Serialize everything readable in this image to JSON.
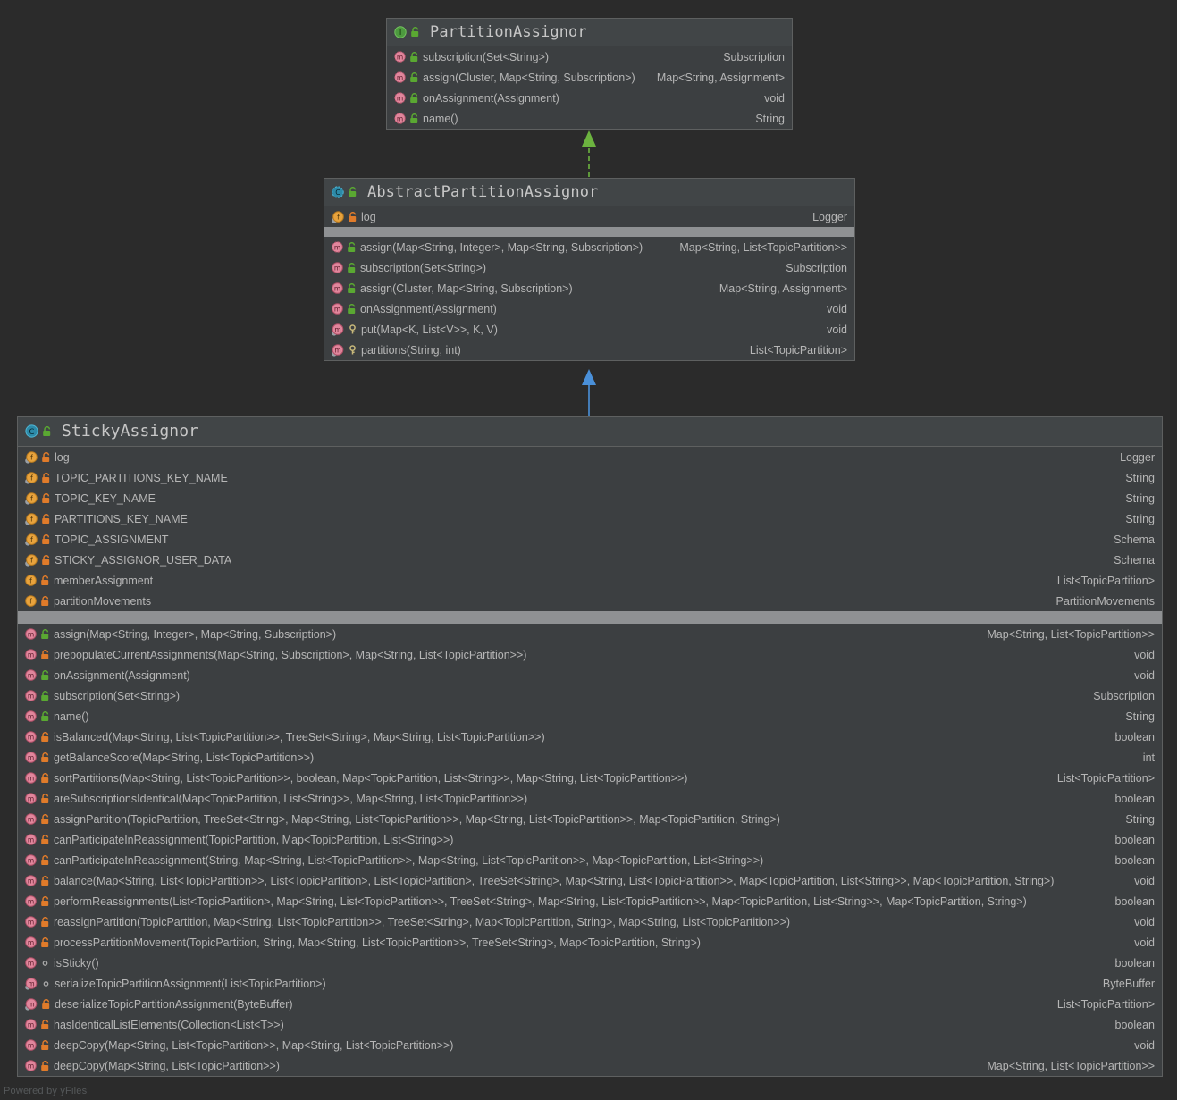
{
  "watermark": "Powered by yFiles",
  "colors": {
    "canvas": "#2b2b2b",
    "box_bg": "#3c3f41",
    "header_bg": "#414547",
    "border": "#5e6060",
    "separator_band": "#8f9193",
    "text": "#b6b6b6",
    "title_text": "#c7c7c7",
    "implements_arrow": "#6cb33f",
    "extends_arrow": "#4a90d9",
    "interface_icon": "#3c9f3c",
    "class_icon": "#2fa8c4",
    "method_icon": "#d9607a",
    "field_icon": "#e8a33d",
    "lock_public": "#5aa832",
    "lock_private": "#e07b2a"
  },
  "connectors": [
    {
      "name": "implements-arrow",
      "style": "dashed",
      "color": "#6cb33f",
      "from": "AbstractPartitionAssignor",
      "to": "PartitionAssignor"
    },
    {
      "name": "extends-arrow",
      "style": "solid",
      "color": "#4a90d9",
      "from": "StickyAssignor",
      "to": "AbstractPartitionAssignor"
    }
  ],
  "classes": [
    {
      "id": "partition-assignor",
      "name": "PartitionAssignor",
      "stereotype": "interface",
      "icon": "interface-icon",
      "visibility_icon": "lock-public-icon",
      "fields": [],
      "methods": [
        {
          "signature": "subscription(Set<String>)",
          "type": "Subscription",
          "icon": "method-abstract-icon",
          "visibility": "lock-public-icon"
        },
        {
          "signature": "assign(Cluster, Map<String, Subscription>)",
          "type": "Map<String, Assignment>",
          "icon": "method-abstract-icon",
          "visibility": "lock-public-icon"
        },
        {
          "signature": "onAssignment(Assignment)",
          "type": "void",
          "icon": "method-abstract-icon",
          "visibility": "lock-public-icon"
        },
        {
          "signature": "name()",
          "type": "String",
          "icon": "method-abstract-icon",
          "visibility": "lock-public-icon"
        }
      ]
    },
    {
      "id": "abstract-partition-assignor",
      "name": "AbstractPartitionAssignor",
      "stereotype": "abstract-class",
      "icon": "abstract-class-icon",
      "visibility_icon": "lock-public-icon",
      "fields": [
        {
          "signature": "log",
          "type": "Logger",
          "icon": "field-static-icon",
          "visibility": "lock-private-icon"
        }
      ],
      "methods": [
        {
          "signature": "assign(Map<String, Integer>, Map<String, Subscription>)",
          "type": "Map<String, List<TopicPartition>>",
          "icon": "method-abstract-icon",
          "visibility": "lock-public-icon"
        },
        {
          "signature": "subscription(Set<String>)",
          "type": "Subscription",
          "icon": "method-icon",
          "visibility": "lock-public-icon"
        },
        {
          "signature": "assign(Cluster, Map<String, Subscription>)",
          "type": "Map<String, Assignment>",
          "icon": "method-icon",
          "visibility": "lock-public-icon"
        },
        {
          "signature": "onAssignment(Assignment)",
          "type": "void",
          "icon": "method-icon",
          "visibility": "lock-public-icon"
        },
        {
          "signature": "put(Map<K, List<V>>, K, V)",
          "type": "void",
          "icon": "method-static-icon",
          "visibility": "key-protected-icon"
        },
        {
          "signature": "partitions(String, int)",
          "type": "List<TopicPartition>",
          "icon": "method-static-icon",
          "visibility": "key-protected-icon"
        }
      ]
    },
    {
      "id": "sticky-assignor",
      "name": "StickyAssignor",
      "stereotype": "class",
      "icon": "class-icon",
      "visibility_icon": "lock-public-icon",
      "fields": [
        {
          "signature": "log",
          "type": "Logger",
          "icon": "field-static-icon",
          "visibility": "lock-private-icon"
        },
        {
          "signature": "TOPIC_PARTITIONS_KEY_NAME",
          "type": "String",
          "icon": "field-static-icon",
          "visibility": "lock-private-icon"
        },
        {
          "signature": "TOPIC_KEY_NAME",
          "type": "String",
          "icon": "field-static-icon",
          "visibility": "lock-private-icon"
        },
        {
          "signature": "PARTITIONS_KEY_NAME",
          "type": "String",
          "icon": "field-static-icon",
          "visibility": "lock-private-icon"
        },
        {
          "signature": "TOPIC_ASSIGNMENT",
          "type": "Schema",
          "icon": "field-static-icon",
          "visibility": "lock-private-icon"
        },
        {
          "signature": "STICKY_ASSIGNOR_USER_DATA",
          "type": "Schema",
          "icon": "field-static-icon",
          "visibility": "lock-private-icon"
        },
        {
          "signature": "memberAssignment",
          "type": "List<TopicPartition>",
          "icon": "field-icon",
          "visibility": "lock-private-icon"
        },
        {
          "signature": "partitionMovements",
          "type": "PartitionMovements",
          "icon": "field-icon",
          "visibility": "lock-private-icon"
        }
      ],
      "methods": [
        {
          "signature": "assign(Map<String, Integer>, Map<String, Subscription>)",
          "type": "Map<String, List<TopicPartition>>",
          "icon": "method-icon",
          "visibility": "lock-public-icon"
        },
        {
          "signature": "prepopulateCurrentAssignments(Map<String, Subscription>, Map<String, List<TopicPartition>>)",
          "type": "void",
          "icon": "method-icon",
          "visibility": "lock-private-icon"
        },
        {
          "signature": "onAssignment(Assignment)",
          "type": "void",
          "icon": "method-icon",
          "visibility": "lock-public-icon"
        },
        {
          "signature": "subscription(Set<String>)",
          "type": "Subscription",
          "icon": "method-icon",
          "visibility": "lock-public-icon"
        },
        {
          "signature": "name()",
          "type": "String",
          "icon": "method-icon",
          "visibility": "lock-public-icon"
        },
        {
          "signature": "isBalanced(Map<String, List<TopicPartition>>, TreeSet<String>, Map<String, List<TopicPartition>>)",
          "type": "boolean",
          "icon": "method-icon",
          "visibility": "lock-private-icon"
        },
        {
          "signature": "getBalanceScore(Map<String, List<TopicPartition>>)",
          "type": "int",
          "icon": "method-icon",
          "visibility": "lock-private-icon"
        },
        {
          "signature": "sortPartitions(Map<String, List<TopicPartition>>, boolean, Map<TopicPartition, List<String>>, Map<String, List<TopicPartition>>)",
          "type": "List<TopicPartition>",
          "icon": "method-icon",
          "visibility": "lock-private-icon"
        },
        {
          "signature": "areSubscriptionsIdentical(Map<TopicPartition, List<String>>, Map<String, List<TopicPartition>>)",
          "type": "boolean",
          "icon": "method-icon",
          "visibility": "lock-private-icon"
        },
        {
          "signature": "assignPartition(TopicPartition, TreeSet<String>, Map<String, List<TopicPartition>>, Map<String, List<TopicPartition>>, Map<TopicPartition, String>)",
          "type": "String",
          "icon": "method-icon",
          "visibility": "lock-private-icon"
        },
        {
          "signature": "canParticipateInReassignment(TopicPartition, Map<TopicPartition, List<String>>)",
          "type": "boolean",
          "icon": "method-icon",
          "visibility": "lock-private-icon"
        },
        {
          "signature": "canParticipateInReassignment(String, Map<String, List<TopicPartition>>, Map<String, List<TopicPartition>>, Map<TopicPartition, List<String>>)",
          "type": "boolean",
          "icon": "method-icon",
          "visibility": "lock-private-icon"
        },
        {
          "signature": "balance(Map<String, List<TopicPartition>>, List<TopicPartition>, List<TopicPartition>, TreeSet<String>, Map<String, List<TopicPartition>>, Map<TopicPartition, List<String>>, Map<TopicPartition, String>)",
          "type": "void",
          "icon": "method-icon",
          "visibility": "lock-private-icon"
        },
        {
          "signature": "performReassignments(List<TopicPartition>, Map<String, List<TopicPartition>>, TreeSet<String>, Map<String, List<TopicPartition>>, Map<TopicPartition, List<String>>, Map<TopicPartition, String>)",
          "type": "boolean",
          "icon": "method-icon",
          "visibility": "lock-private-icon"
        },
        {
          "signature": "reassignPartition(TopicPartition, Map<String, List<TopicPartition>>, TreeSet<String>, Map<TopicPartition, String>, Map<String, List<TopicPartition>>)",
          "type": "void",
          "icon": "method-icon",
          "visibility": "lock-private-icon"
        },
        {
          "signature": "processPartitionMovement(TopicPartition, String, Map<String, List<TopicPartition>>, TreeSet<String>, Map<TopicPartition, String>)",
          "type": "void",
          "icon": "method-icon",
          "visibility": "lock-private-icon"
        },
        {
          "signature": "isSticky()",
          "type": "boolean",
          "icon": "method-icon",
          "visibility": "package-private-icon"
        },
        {
          "signature": "serializeTopicPartitionAssignment(List<TopicPartition>)",
          "type": "ByteBuffer",
          "icon": "method-static-icon",
          "visibility": "package-private-icon"
        },
        {
          "signature": "deserializeTopicPartitionAssignment(ByteBuffer)",
          "type": "List<TopicPartition>",
          "icon": "method-static-icon",
          "visibility": "lock-private-icon"
        },
        {
          "signature": "hasIdenticalListElements(Collection<List<T>>)",
          "type": "boolean",
          "icon": "method-icon",
          "visibility": "lock-private-icon"
        },
        {
          "signature": "deepCopy(Map<String, List<TopicPartition>>, Map<String, List<TopicPartition>>)",
          "type": "void",
          "icon": "method-icon",
          "visibility": "lock-private-icon"
        },
        {
          "signature": "deepCopy(Map<String, List<TopicPartition>>)",
          "type": "Map<String, List<TopicPartition>>",
          "icon": "method-icon",
          "visibility": "lock-private-icon"
        }
      ]
    }
  ]
}
